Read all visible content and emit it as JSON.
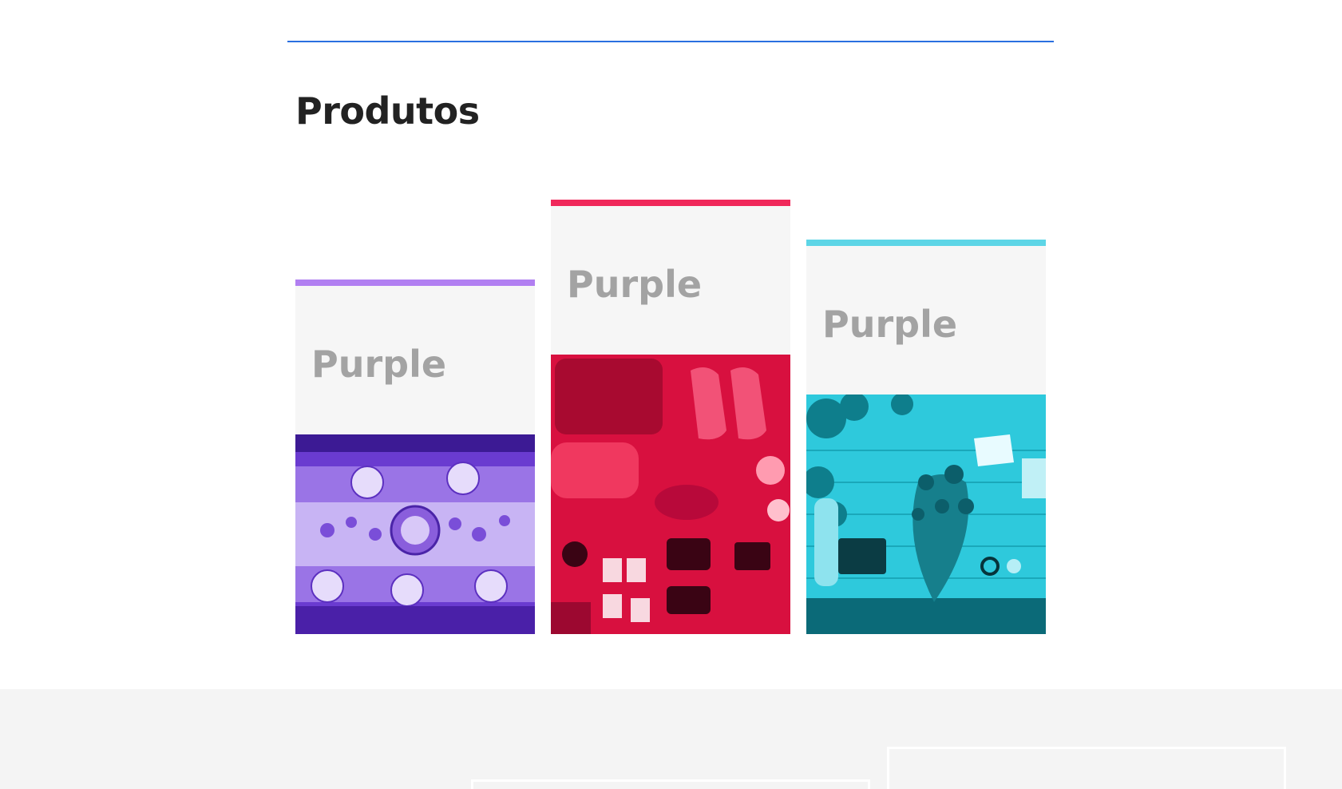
{
  "products_section": {
    "title": "Produtos",
    "cards": [
      {
        "title": "Purple",
        "accent_color": "#b17ff1",
        "image_tint": "#7b45e0",
        "image_subject": "table-setting-photo"
      },
      {
        "title": "Purple",
        "accent_color": "#f0285a",
        "image_tint": "#e8174a",
        "image_subject": "travel-gear-photo"
      },
      {
        "title": "Purple",
        "accent_color": "#5dd5e6",
        "image_tint": "#27c9dc",
        "image_subject": "workbench-flowers-photo"
      }
    ]
  },
  "colors": {
    "divider": "#2a6fe0",
    "card_head_bg": "#f6f6f6",
    "footer_bg": "#f4f4f4"
  }
}
